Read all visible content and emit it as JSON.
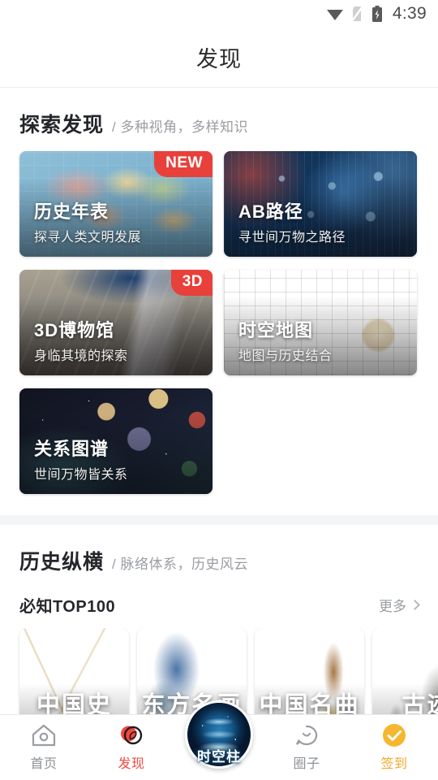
{
  "statusbar": {
    "time": "4:39",
    "wifi_icon": "wifi-icon",
    "sim_icon": "sim-card-off-icon",
    "battery_icon": "battery-charging-icon"
  },
  "header": {
    "title": "发现"
  },
  "sections": [
    {
      "title": "探索发现",
      "subtitle": "/ 多种视角，多样知识",
      "cards": [
        {
          "title": "历史年表",
          "subtitle": "探寻人类文明发展",
          "badge": "NEW",
          "art": "art-map"
        },
        {
          "title": "AB路径",
          "subtitle": "寻世间万物之路径",
          "badge": "",
          "art": "art-net"
        },
        {
          "title": "3D博物馆",
          "subtitle": "身临其境的探索",
          "badge": "3D",
          "art": "art-museum"
        },
        {
          "title": "时空地图",
          "subtitle": "地图与历史结合",
          "badge": "",
          "art": "art-compass"
        },
        {
          "title": "关系图谱",
          "subtitle": "世间万物皆关系",
          "badge": "",
          "art": "art-stars"
        }
      ]
    },
    {
      "title": "历史纵横",
      "subtitle": "/ 脉络体系，历史风云",
      "sub_head": {
        "title": "必知TOP100",
        "more": "更多"
      },
      "tiles": [
        {
          "title": "中国史",
          "art": "art-city"
        },
        {
          "title": "东方名画",
          "art": "art-paint"
        },
        {
          "title": "中国名曲",
          "art": "art-music"
        },
        {
          "title": "古迹",
          "art": "art-ruin"
        }
      ]
    }
  ],
  "tabbar": {
    "items": [
      {
        "label": "首页",
        "icon": "home-icon",
        "state": "inactive"
      },
      {
        "label": "发现",
        "icon": "compass-icon",
        "state": "active"
      },
      {
        "label": "时空柱",
        "icon": "time-pillar-orb-icon",
        "state": "center"
      },
      {
        "label": "圈子",
        "icon": "chat-circle-icon",
        "state": "inactive"
      },
      {
        "label": "签到",
        "icon": "check-badge-icon",
        "state": "gold"
      }
    ]
  },
  "colors": {
    "accent_red": "#f4483f",
    "badge_red": "#e8403a",
    "gold": "#f0a82a",
    "muted": "#9a9da3"
  }
}
